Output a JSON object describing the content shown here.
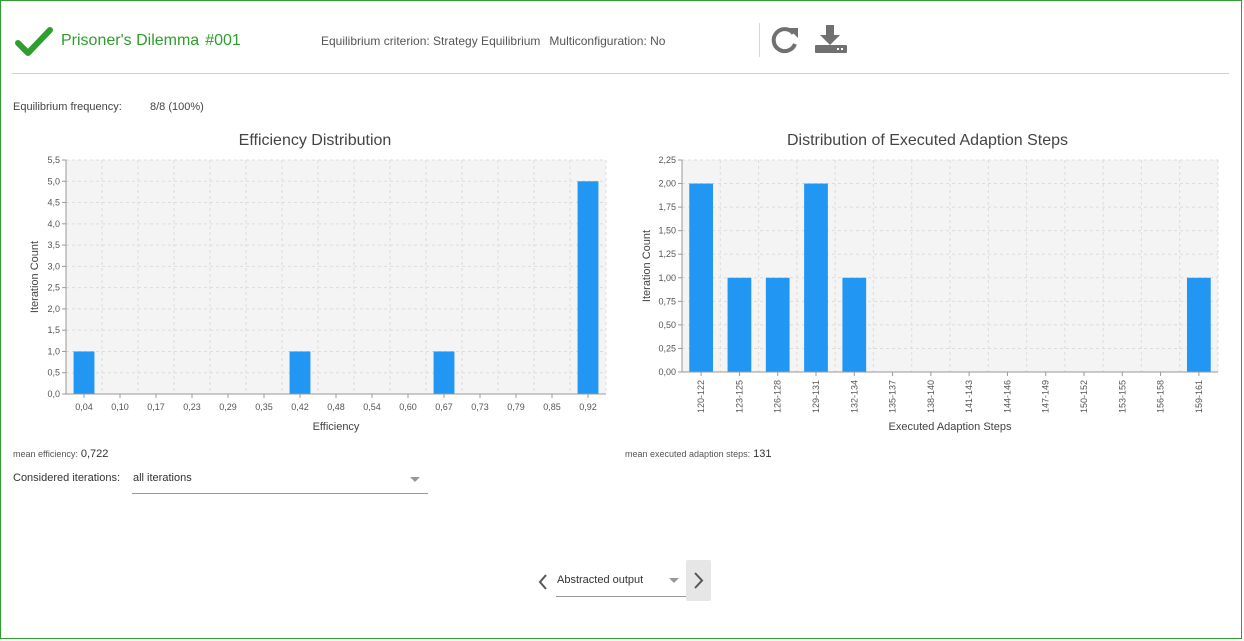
{
  "header": {
    "title": "Prisoner's Dilemma",
    "number": "#001",
    "equilibrium_criterion": "Equilibrium criterion: Strategy Equilibrium",
    "multiconfiguration": "Multiconfiguration: No",
    "check_icon": "check-icon",
    "refresh_icon": "refresh-icon",
    "download_icon": "download-icon",
    "accent_color": "#2e9e2e"
  },
  "equilibrium_frequency": {
    "label": "Equilibrium frequency:",
    "value": "8/8 (100%)"
  },
  "chart_data": [
    {
      "type": "bar",
      "title": "Efficiency Distribution",
      "xlabel": "Efficiency",
      "ylabel": "Iteration Count",
      "categories": [
        "0,04",
        "0,10",
        "0,17",
        "0,23",
        "0,29",
        "0,35",
        "0,42",
        "0,48",
        "0,54",
        "0,60",
        "0,67",
        "0,73",
        "0,79",
        "0,85",
        "0,92"
      ],
      "values": [
        1,
        0,
        0,
        0,
        0,
        0,
        1,
        0,
        0,
        0,
        1,
        0,
        0,
        0,
        5
      ],
      "yticks": [
        "0,0",
        "0,5",
        "1,0",
        "1,5",
        "2,0",
        "2,5",
        "3,0",
        "3,5",
        "4,0",
        "4,5",
        "5,0",
        "5,5"
      ],
      "ylim": [
        0,
        5.5
      ],
      "grid": true,
      "bar_color": "#2196f3"
    },
    {
      "type": "bar",
      "title": "Distribution of Executed Adaption Steps",
      "xlabel": "Executed Adaption Steps",
      "ylabel": "Iteration Count",
      "categories": [
        "120-122",
        "123-125",
        "126-128",
        "129-131",
        "132-134",
        "135-137",
        "138-140",
        "141-143",
        "144-146",
        "147-149",
        "150-152",
        "153-155",
        "156-158",
        "159-161"
      ],
      "values": [
        2,
        1,
        1,
        2,
        1,
        0,
        0,
        0,
        0,
        0,
        0,
        0,
        0,
        1
      ],
      "yticks": [
        "0,00",
        "0,25",
        "0,50",
        "0,75",
        "1,00",
        "1,25",
        "1,50",
        "1,75",
        "2,00",
        "2,25"
      ],
      "ylim": [
        0,
        2.25
      ],
      "grid": true,
      "bar_color": "#2196f3"
    }
  ],
  "stats": {
    "mean_efficiency_label": "mean efficiency:",
    "mean_efficiency_value": "0,722",
    "mean_steps_label": "mean executed adaption steps:",
    "mean_steps_value": "131"
  },
  "considered": {
    "label": "Considered iterations:",
    "value": "all iterations"
  },
  "pager": {
    "value": "Abstracted output",
    "prev_icon": "chevron-left-icon",
    "next_icon": "chevron-right-icon"
  }
}
